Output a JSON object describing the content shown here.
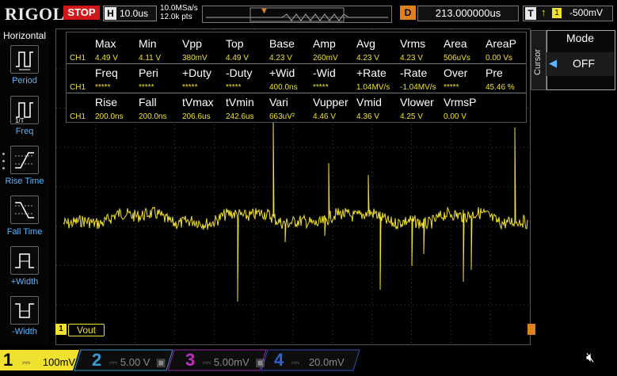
{
  "header": {
    "logo": "RIGOL",
    "run_state": "STOP",
    "horizontal_label": "H",
    "timebase": "10.0us",
    "sample_rate": "10.0MSa/s",
    "memory_depth": "12.0k pts",
    "delay_label": "D",
    "delay_value": "213.000000us",
    "trigger_label": "T",
    "trigger_slope": "↑",
    "trigger_source": "1",
    "trigger_level": "-500mV"
  },
  "left_panel": {
    "title": "Horizontal",
    "items": [
      {
        "label": "Period"
      },
      {
        "label": "Freq"
      },
      {
        "label": "Rise Time"
      },
      {
        "label": "Fall Time"
      },
      {
        "label": "+Width"
      },
      {
        "label": "-Width"
      }
    ]
  },
  "measurements": {
    "row1_headers": [
      "Max",
      "Min",
      "Vpp",
      "Top",
      "Base",
      "Amp",
      "Avg",
      "Vrms",
      "Area",
      "AreaP"
    ],
    "row1_values": [
      "CH1",
      "4.49 V",
      "4.11 V",
      "380mV",
      "4.49 V",
      "4.23 V",
      "260mV",
      "4.23 V",
      "4.23 V",
      "506uVs",
      "0.00 Vs"
    ],
    "row2_headers": [
      "Freq",
      "Peri",
      "+Duty",
      "-Duty",
      "+Wid",
      "-Wid",
      "+Rate",
      "-Rate",
      "Over",
      "Pre"
    ],
    "row2_values": [
      "CH1",
      "*****",
      "*****",
      "*****",
      "*****",
      "400.0ns",
      "*****",
      "1.04MV/s",
      "-1.04MV/s",
      "*****",
      "45.46 %"
    ],
    "row3_headers": [
      "Rise",
      "Fall",
      "tVmax",
      "tVmin",
      "Vari",
      "Vupper",
      "Vmid",
      "Vlower",
      "VrmsP"
    ],
    "row3_values": [
      "CH1",
      "200.0ns",
      "200.0ns",
      "206.6us",
      "242.6us",
      "663uV²",
      "4.46 V",
      "4.36 V",
      "4.25 V",
      "0.00 V"
    ]
  },
  "right_panel": {
    "tab_label": "Cursor",
    "mode_title": "Mode",
    "mode_value": "OFF"
  },
  "waveform": {
    "channel_marker": "1",
    "channel_label": "Vout",
    "color": "#f0e030"
  },
  "bottom_bar": {
    "channels": [
      {
        "num": "1",
        "scale": "100mV",
        "color": "#f0e030"
      },
      {
        "num": "2",
        "scale": "5.00 V",
        "color": "#3a9ad0"
      },
      {
        "num": "3",
        "scale": "5.00mV",
        "color": "#c030c0"
      },
      {
        "num": "4",
        "scale": "20.0mV",
        "color": "#3060d0"
      }
    ],
    "speaker_icon": "speaker-mute-icon"
  }
}
